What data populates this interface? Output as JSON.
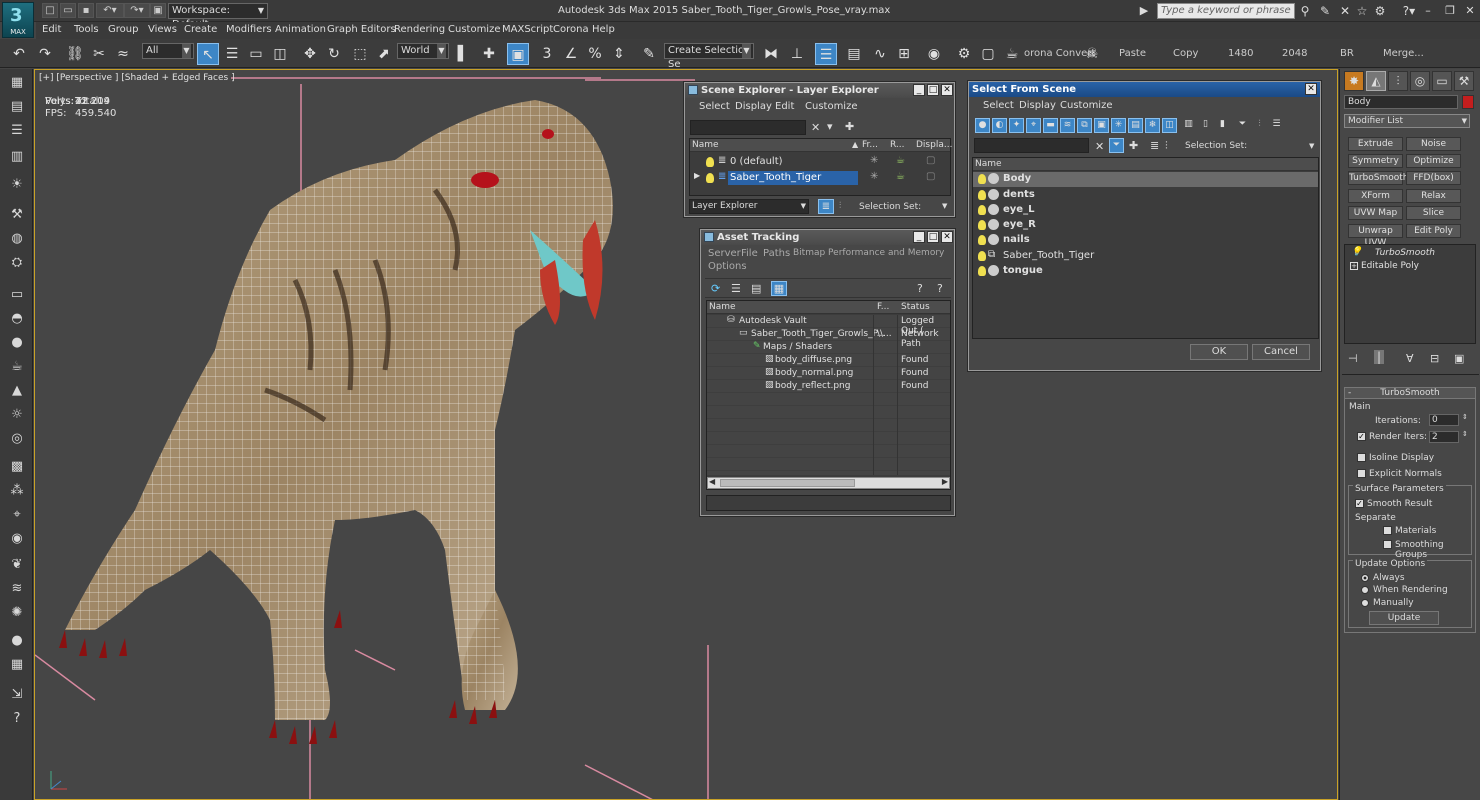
{
  "app": {
    "logo_text": "MAX",
    "workspace": "Workspace: Default",
    "title": "Autodesk 3ds Max  2015     Saber_Tooth_Tiger_Growls_Pose_vray.max",
    "help_search_placeholder": "Type a keyword or phrase",
    "accent": "#3d86c6"
  },
  "menus": [
    "Edit",
    "Tools",
    "Group",
    "Views",
    "Create",
    "Modifiers",
    "Animation",
    "Graph Editors",
    "Rendering",
    "Customize",
    "MAXScript",
    "Corona",
    "Help"
  ],
  "toolbar": {
    "filter": "All",
    "coord_system": "World",
    "selection_set_placeholder": "Create Selection Se",
    "extra_labels": [
      "orona Convert",
      "Paste",
      "Copy",
      "1480",
      "2048",
      "BR",
      "Merge..."
    ]
  },
  "viewport": {
    "label": "[+] [Perspective ] [Shaded + Edged Faces ]",
    "stats_header": "Total",
    "polys_label": "Polys:",
    "polys_value": "42 214",
    "verts_label": "Verts:",
    "verts_value": "21 209",
    "fps_label": "FPS:",
    "fps_value": "459.540"
  },
  "scene_explorer": {
    "title": "Scene Explorer - Layer Explorer",
    "menus": [
      "Select",
      "Display",
      "Edit",
      "Customize"
    ],
    "columns": [
      "Name",
      "Fr...",
      "R...",
      "Displa..."
    ],
    "rows": [
      {
        "name": "0 (default)",
        "selected": false
      },
      {
        "name": "Saber_Tooth_Tiger",
        "selected": true
      }
    ],
    "footer_dropdown": "Layer Explorer",
    "selection_set_label": "Selection Set:"
  },
  "asset_tracking": {
    "title": "Asset Tracking",
    "menus": [
      "Server",
      "File",
      "Paths",
      "Bitmap Performance and Memory",
      "Options"
    ],
    "columns": [
      "Name",
      "F...",
      "Status"
    ],
    "rows": [
      {
        "name": "Autodesk Vault",
        "f": "",
        "status": "Logged Out ("
      },
      {
        "name": "Saber_Tooth_Tiger_Growls_P...",
        "f": "\\\\...",
        "status": "Network Path"
      },
      {
        "name": "Maps / Shaders",
        "f": "",
        "status": ""
      },
      {
        "name": "body_diffuse.png",
        "f": "",
        "status": "Found"
      },
      {
        "name": "body_normal.png",
        "f": "",
        "status": "Found"
      },
      {
        "name": "body_reflect.png",
        "f": "",
        "status": "Found"
      }
    ]
  },
  "select_from_scene": {
    "title": "Select From Scene",
    "menus": [
      "Select",
      "Display",
      "Customize"
    ],
    "selection_set_label": "Selection Set:",
    "column": "Name",
    "rows": [
      "Body",
      "dents",
      "eye_L",
      "eye_R",
      "nails",
      "Saber_Tooth_Tiger",
      "tongue"
    ],
    "ok": "OK",
    "cancel": "Cancel"
  },
  "command_panel": {
    "object_name": "Body",
    "object_color": "#c41e1e",
    "modifier_list": "Modifier List",
    "modifier_buttons": [
      "Extrude",
      "Noise",
      "Symmetry",
      "Optimize",
      "TurboSmooth",
      "FFD(box)",
      "XForm",
      "Relax",
      "UVW Map",
      "Slice",
      "Unwrap UVW",
      "Edit Poly"
    ],
    "stack": [
      "TurboSmooth",
      "Editable Poly"
    ],
    "rollout_title": "TurboSmooth",
    "main_label": "Main",
    "iterations_label": "Iterations:",
    "iterations_value": "0",
    "render_iters_label": "Render Iters:",
    "render_iters_value": "2",
    "isoline_label": "Isoline Display",
    "explicit_normals_label": "Explicit Normals",
    "surface_params_label": "Surface Parameters",
    "smooth_result_label": "Smooth Result",
    "separate_label": "Separate",
    "materials_label": "Materials",
    "smoothing_groups_label": "Smoothing Groups",
    "update_options_label": "Update Options",
    "always_label": "Always",
    "when_rendering_label": "When Rendering",
    "manually_label": "Manually",
    "update_button": "Update"
  }
}
